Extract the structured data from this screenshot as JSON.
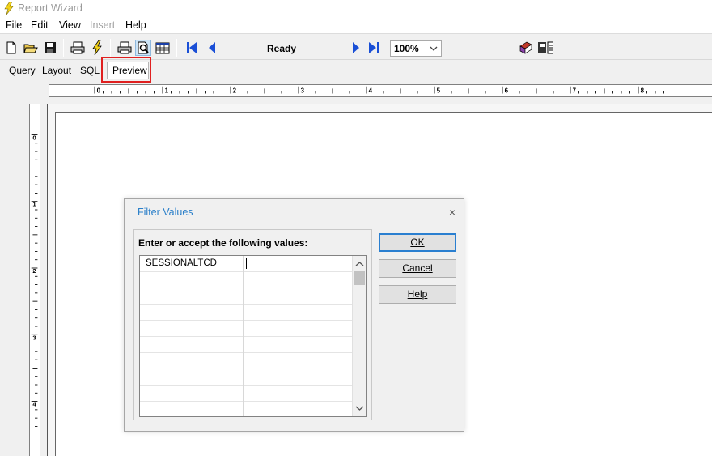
{
  "window": {
    "title": "Report Wizard",
    "icon": "lightning-icon"
  },
  "menu": [
    {
      "label": "File",
      "enabled": true
    },
    {
      "label": "Edit",
      "enabled": true
    },
    {
      "label": "View",
      "enabled": true
    },
    {
      "label": "Insert",
      "enabled": false
    },
    {
      "label": "Help",
      "enabled": true
    }
  ],
  "toolbar": {
    "status": "Ready",
    "zoom": "100%",
    "icons": [
      "new-icon",
      "open-icon",
      "save-icon",
      "print-setup-icon",
      "run-icon",
      "print-icon",
      "preview-icon",
      "grid-icon",
      "first-page-icon",
      "prev-page-icon",
      "next-page-icon",
      "last-page-icon",
      "book-icon",
      "export-icon"
    ]
  },
  "tabs": {
    "query": "Query",
    "layout": "Layout",
    "sql": "SQL",
    "preview": "Preview",
    "active": "Preview"
  },
  "ruler": {
    "h": [
      "0",
      "1",
      "2",
      "3",
      "4",
      "5",
      "6",
      "7",
      "8"
    ],
    "v": [
      "0",
      "1",
      "2",
      "3",
      "4"
    ]
  },
  "dialog": {
    "title": "Filter Values",
    "close": "×",
    "prompt": "Enter or accept the following values:",
    "rows": [
      {
        "name": "SESSIONALTCD",
        "value": ""
      }
    ],
    "buttons": {
      "ok": "OK",
      "cancel": "Cancel",
      "help": "Help"
    }
  },
  "colors": {
    "dialog_title": "#2a7fc9",
    "highlight": "#e02020",
    "nav_arrow": "#1a4fd6"
  }
}
